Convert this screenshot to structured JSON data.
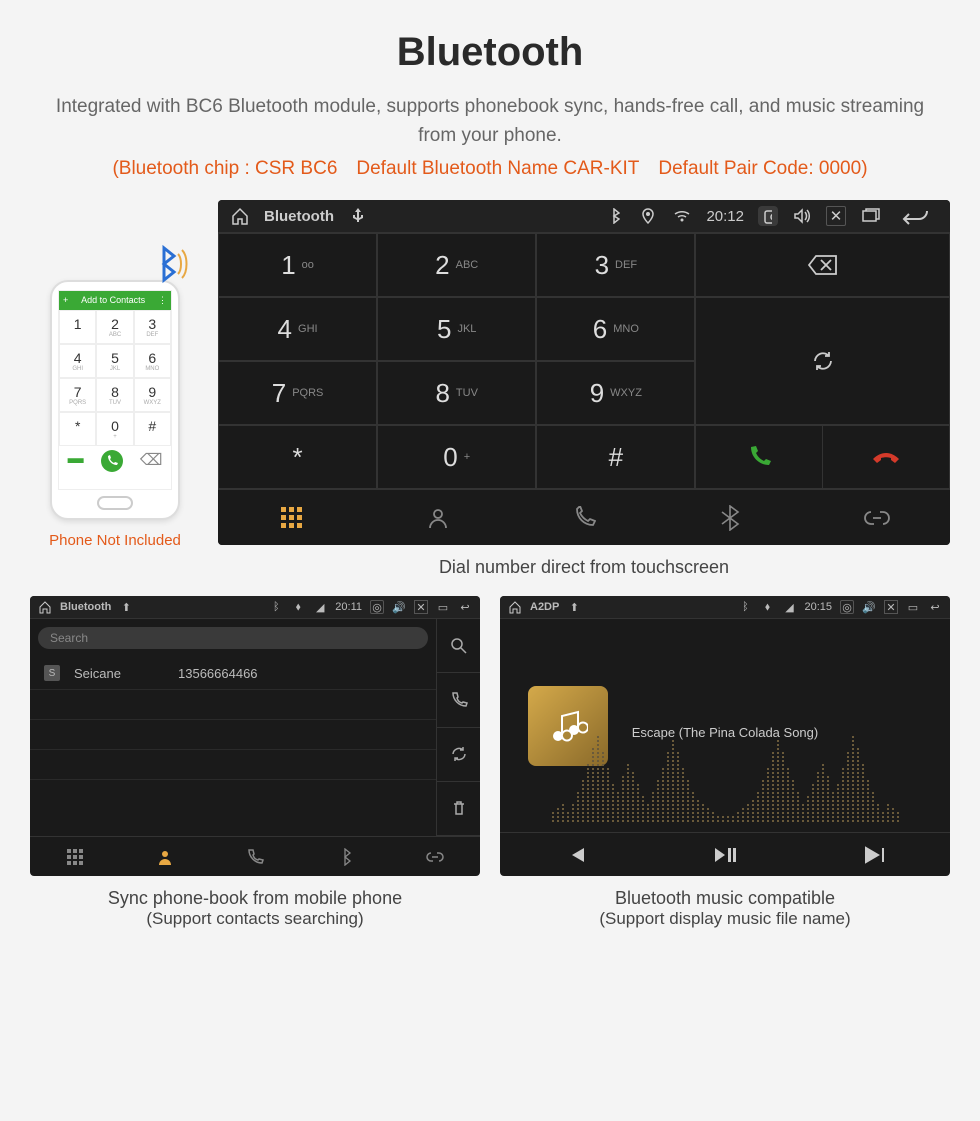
{
  "title": "Bluetooth",
  "subtitle": "Integrated with BC6 Bluetooth module, supports phonebook sync, hands-free call, and music streaming from your phone.",
  "spec_line": "(Bluetooth chip : CSR BC6 Default Bluetooth Name CAR-KIT Default Pair Code: 0000)",
  "phone": {
    "header_left": "+",
    "header_right": "Add to Contacts",
    "keys": [
      {
        "n": "1",
        "l": ""
      },
      {
        "n": "2",
        "l": "ABC"
      },
      {
        "n": "3",
        "l": "DEF"
      },
      {
        "n": "4",
        "l": "GHI"
      },
      {
        "n": "5",
        "l": "JKL"
      },
      {
        "n": "6",
        "l": "MNO"
      },
      {
        "n": "7",
        "l": "PQRS"
      },
      {
        "n": "8",
        "l": "TUV"
      },
      {
        "n": "9",
        "l": "WXYZ"
      },
      {
        "n": "*",
        "l": ""
      },
      {
        "n": "0",
        "l": "+"
      },
      {
        "n": "#",
        "l": ""
      }
    ],
    "caption": "Phone Not Included"
  },
  "dialer": {
    "app_title": "Bluetooth",
    "clock": "20:12",
    "keys": [
      {
        "n": "1",
        "l": "oo"
      },
      {
        "n": "2",
        "l": "ABC"
      },
      {
        "n": "3",
        "l": "DEF"
      },
      {
        "n": "4",
        "l": "GHI"
      },
      {
        "n": "5",
        "l": "JKL"
      },
      {
        "n": "6",
        "l": "MNO"
      },
      {
        "n": "7",
        "l": "PQRS"
      },
      {
        "n": "8",
        "l": "TUV"
      },
      {
        "n": "9",
        "l": "WXYZ"
      },
      {
        "n": "*",
        "l": ""
      },
      {
        "n": "0",
        "l": "+"
      },
      {
        "n": "#",
        "l": ""
      }
    ],
    "caption": "Dial number direct from touchscreen"
  },
  "phonebook": {
    "app_title": "Bluetooth",
    "clock": "20:11",
    "search_placeholder": "Search",
    "contact_initial": "S",
    "contact_name": "Seicane",
    "contact_number": "13566664466",
    "caption_l1": "Sync phone-book from mobile phone",
    "caption_l2": "(Support contacts searching)"
  },
  "music": {
    "app_title": "A2DP",
    "clock": "20:15",
    "track": "Escape (The Pina Colada Song)",
    "caption_l1": "Bluetooth music compatible",
    "caption_l2": "(Support display music file name)"
  }
}
